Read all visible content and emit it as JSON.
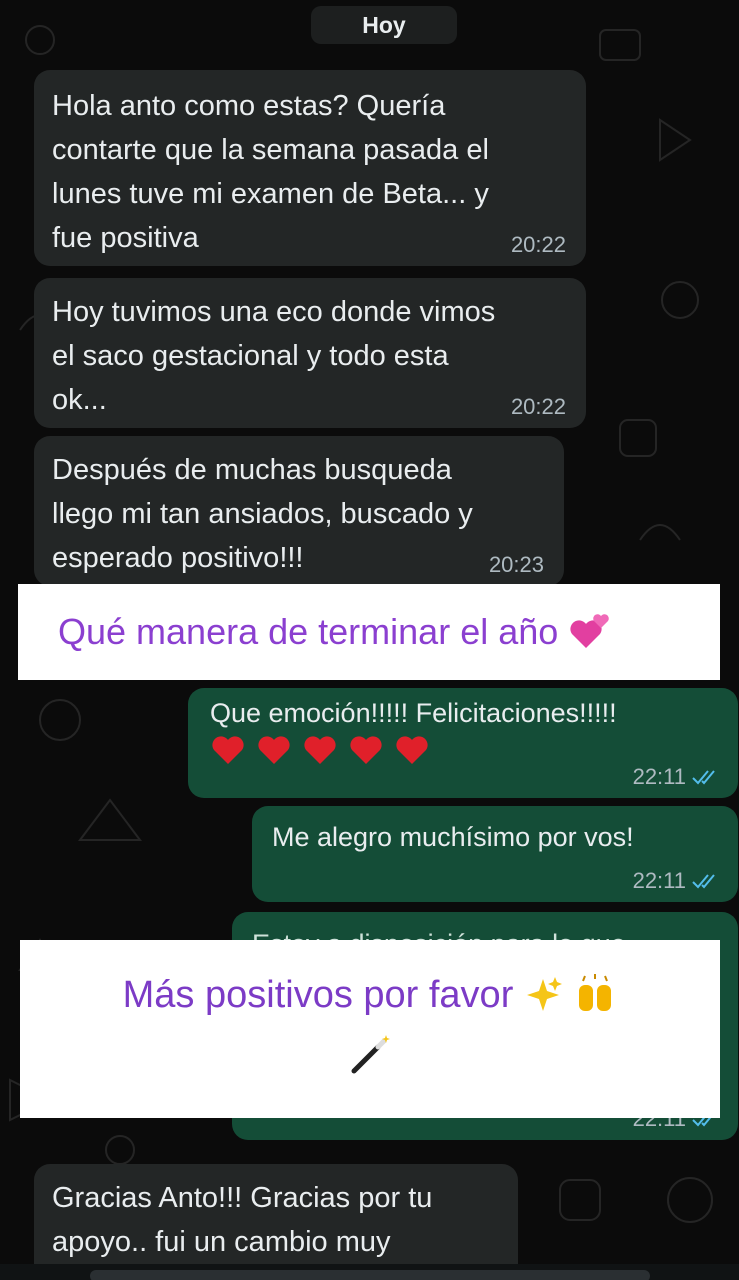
{
  "date_chip": "Hoy",
  "messages": [
    {
      "text": "Hola anto como estas? Quería\ncontarte  que la semana pasada el\nlunes tuve  mi examen de Beta... y\nfue positiva",
      "time": "20:22"
    },
    {
      "text": "Hoy tuvimos una eco donde vimos\nel saco gestacional  y todo esta\nok...",
      "time": "20:22"
    },
    {
      "text": "Después de muchas busqueda\nllego mi tan ansiados, buscado y\nesperado  positivo!!!",
      "time": "20:23"
    },
    {
      "text": "Que emoción!!!!! Felicitaciones!!!!!",
      "time": "22:11"
    },
    {
      "text": "Me alegro muchísimo por vos!",
      "time": "22:11"
    },
    {
      "text": "Estoy a disposición para lo que",
      "time": "22:11"
    },
    {
      "text": "Gracias  Anto!!!  Gracias  por tu\napoyo.. fui un cambio   muy"
    }
  ],
  "overlays": {
    "caption1": "Qué manera de terminar el año",
    "caption2": "Más positivos por favor"
  },
  "colors": {
    "incoming_bubble": "#232626",
    "outgoing_bubble": "#144d37",
    "caption_text": "#8b3fd0",
    "read_ticks": "#53bdeb"
  },
  "icons": {
    "hearts": "red-heart-icon",
    "read_receipt": "double-check-icon",
    "sparkles": "sparkles-icon",
    "raised_hands": "raised-hands-icon",
    "magic_wand": "magic-wand-icon",
    "heart_emoji": "two-hearts-icon"
  }
}
